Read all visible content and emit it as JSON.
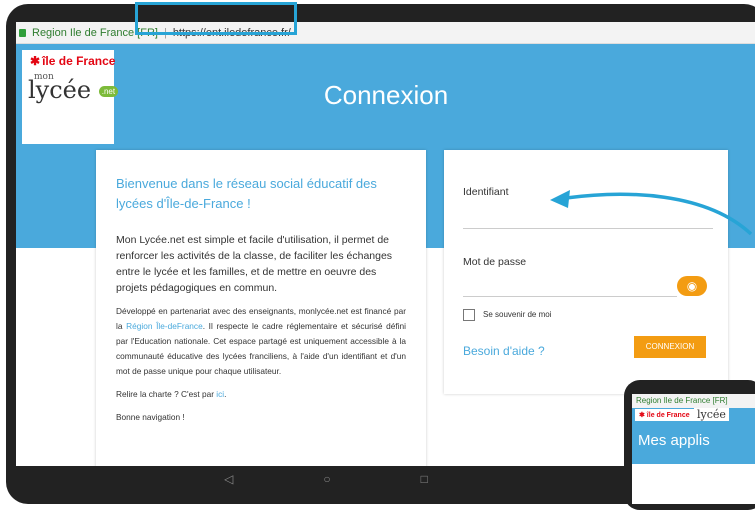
{
  "browser": {
    "site_name": "Region Ile de France [FR]",
    "url": "https://ent.iledefrance.fr/"
  },
  "logos": {
    "idf_star": "✱",
    "idf_text": "île de France",
    "lycee_mon": "mon",
    "lycee_text": "lycée",
    "lycee_net": ".net"
  },
  "page": {
    "title": "Connexion"
  },
  "welcome": {
    "heading": "Bienvenue dans le réseau social éducatif des lycées d'Île-de-France !",
    "intro": "Mon Lycée.net est simple et facile d'utilisation, il permet de renforcer les activités de la classe, de faciliter les échanges entre le lycée et les familles, et de mettre en oeuvre des projets pédagogiques en commun.",
    "details_before": "Développé en partenariat avec des enseignants, monlycée.net est financé par la ",
    "details_link": "Région Île-deFrance",
    "details_after": ". Il respecte le cadre réglementaire et sécurisé défini par l'Education nationale. Cet espace partagé est uniquement accessible à la communauté éducative des lycées franciliens, à l'aide d'un identifiant et d'un mot de passe unique pour chaque utilisateur.",
    "charter_prefix": "Relire la charte ? C'est par ",
    "charter_link": "ici",
    "charter_suffix": ".",
    "goodbye": "Bonne navigation !"
  },
  "login": {
    "identifier_label": "Identifiant",
    "password_label": "Mot de passe",
    "remember_label": "Se souvenir de moi",
    "help_link": "Besoin d'aide ?",
    "submit_label": "CONNEXION",
    "eye_icon": "◉"
  },
  "phone": {
    "site_name": "Region Ile de France [FR]",
    "idf_text": "✱ île de France",
    "lycee_text": "lycée",
    "apps_title": "Mes applis"
  },
  "navbar": {
    "back_icon": "◁",
    "home_icon": "○",
    "recent_icon": "□"
  },
  "colors": {
    "primary_blue": "#4aa9dc",
    "accent_orange": "#f39c12",
    "highlight_border": "#27a4d6"
  }
}
